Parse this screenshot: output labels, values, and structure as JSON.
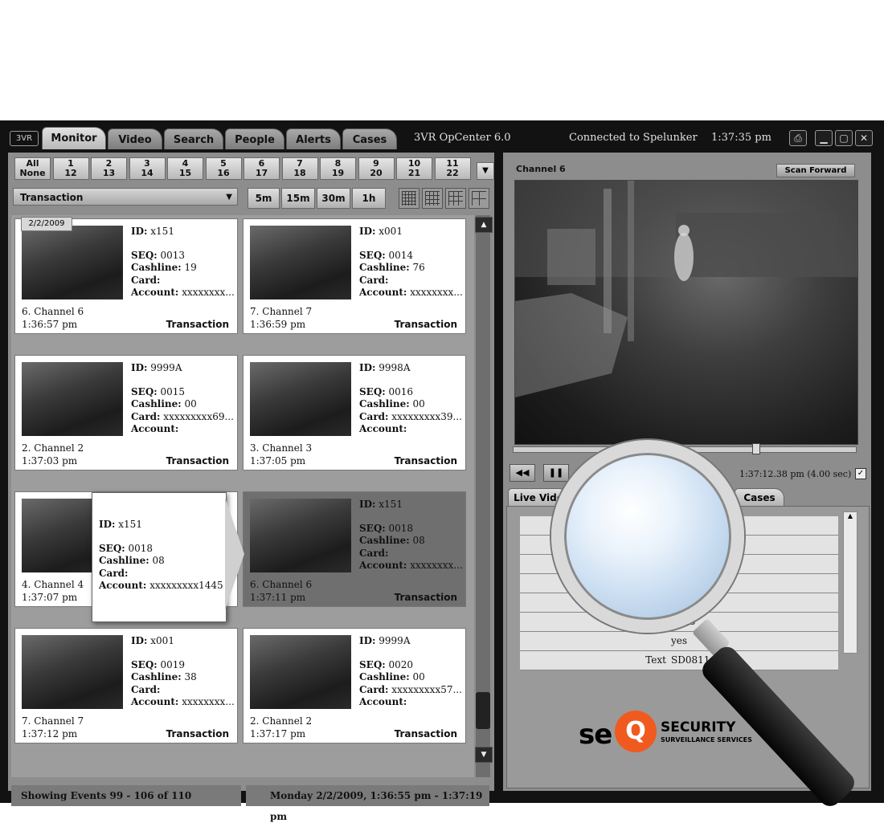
{
  "app": {
    "logo": "3VR",
    "title": "3VR OpCenter 6.0",
    "connection": "Connected to Spelunker",
    "clock": "1:37:35 pm"
  },
  "tabs": [
    "Monitor",
    "Video",
    "Search",
    "People",
    "Alerts",
    "Cases"
  ],
  "window_controls": [
    "printer-icon",
    "minimize-icon",
    "maximize-icon",
    "close-icon"
  ],
  "channel_buttons": [
    {
      "top": "All",
      "bottom": "None"
    },
    {
      "top": "1",
      "bottom": "12"
    },
    {
      "top": "2",
      "bottom": "13"
    },
    {
      "top": "3",
      "bottom": "14"
    },
    {
      "top": "4",
      "bottom": "15"
    },
    {
      "top": "5",
      "bottom": "16"
    },
    {
      "top": "6",
      "bottom": "17"
    },
    {
      "top": "7",
      "bottom": "18"
    },
    {
      "top": "8",
      "bottom": "19"
    },
    {
      "top": "9",
      "bottom": "20"
    },
    {
      "top": "10",
      "bottom": "21"
    },
    {
      "top": "11",
      "bottom": "22"
    }
  ],
  "filter": {
    "selected": "Transaction"
  },
  "ranges": [
    "5m",
    "15m",
    "30m",
    "1h"
  ],
  "date_tag": "2/2/2009",
  "events": [
    {
      "id": "x151",
      "seq": "0013",
      "cashline": "19",
      "card": "",
      "account": "xxxxxxxx...",
      "channel": "6. Channel 6",
      "time": "1:36:57 pm",
      "type": "Transaction"
    },
    {
      "id": "x001",
      "seq": "0014",
      "cashline": "76",
      "card": "",
      "account": "xxxxxxxx...",
      "channel": "7. Channel 7",
      "time": "1:36:59 pm",
      "type": "Transaction"
    },
    {
      "id": "9999A",
      "seq": "0015",
      "cashline": "00",
      "card": "xxxxxxxxx69...",
      "account": "",
      "channel": "2. Channel 2",
      "time": "1:37:03 pm",
      "type": "Transaction"
    },
    {
      "id": "9998A",
      "seq": "0016",
      "cashline": "00",
      "card": "xxxxxxxxx39...",
      "account": "",
      "channel": "3. Channel 3",
      "time": "1:37:05 pm",
      "type": "Transaction"
    },
    {
      "id": "",
      "seq": "",
      "cashline": "",
      "card": "",
      "account": "",
      "channel": "4. Channel 4",
      "time": "1:37:07 pm",
      "type": ""
    },
    {
      "id": "x151",
      "seq": "0018",
      "cashline": "08",
      "card": "",
      "account": "xxxxxxxx...",
      "channel": "6. Channel 6",
      "time": "1:37:11 pm",
      "type": "Transaction"
    },
    {
      "id": "x001",
      "seq": "0019",
      "cashline": "38",
      "card": "",
      "account": "xxxxxxxx...",
      "channel": "7. Channel 7",
      "time": "1:37:12 pm",
      "type": "Transaction"
    },
    {
      "id": "9999A",
      "seq": "0020",
      "cashline": "00",
      "card": "xxxxxxxxx57...",
      "account": "",
      "channel": "2. Channel 2",
      "time": "1:37:17 pm",
      "type": "Transaction"
    }
  ],
  "labels": {
    "id": "ID:",
    "seq": "SEQ:",
    "cashline": "Cashline:",
    "card": "Card:",
    "account": "Account:"
  },
  "popup": {
    "id": "x151",
    "seq": "0018",
    "cashline": "08",
    "card": "",
    "account": "xxxxxxxxx1445"
  },
  "status": {
    "left": "Showing Events 99 - 106 of 110",
    "right": "Monday 2/2/2009, 1:36:55 pm - 1:37:19 pm"
  },
  "video": {
    "channel": "Channel 6",
    "scan_button": "Scan Forward",
    "timestamp": "1:37:12.38 pm (4.00 sec)"
  },
  "bottom_tabs": [
    "Live Vide",
    "Cases"
  ],
  "table_rows": [
    {
      "key": "",
      "value": ""
    },
    {
      "key": "",
      "value": ""
    },
    {
      "key": "",
      "value": ""
    },
    {
      "key": "",
      "value": ""
    },
    {
      "key": "",
      "value": ""
    },
    {
      "key": "",
      "value": "1445"
    },
    {
      "key": "",
      "value": "yes"
    },
    {
      "key": "Text",
      "value": "SD0811"
    }
  ],
  "brand": {
    "se": "se",
    "q": "Q",
    "security": "SECURITY",
    "sub": "SURVEILLANCE SERVICES"
  }
}
